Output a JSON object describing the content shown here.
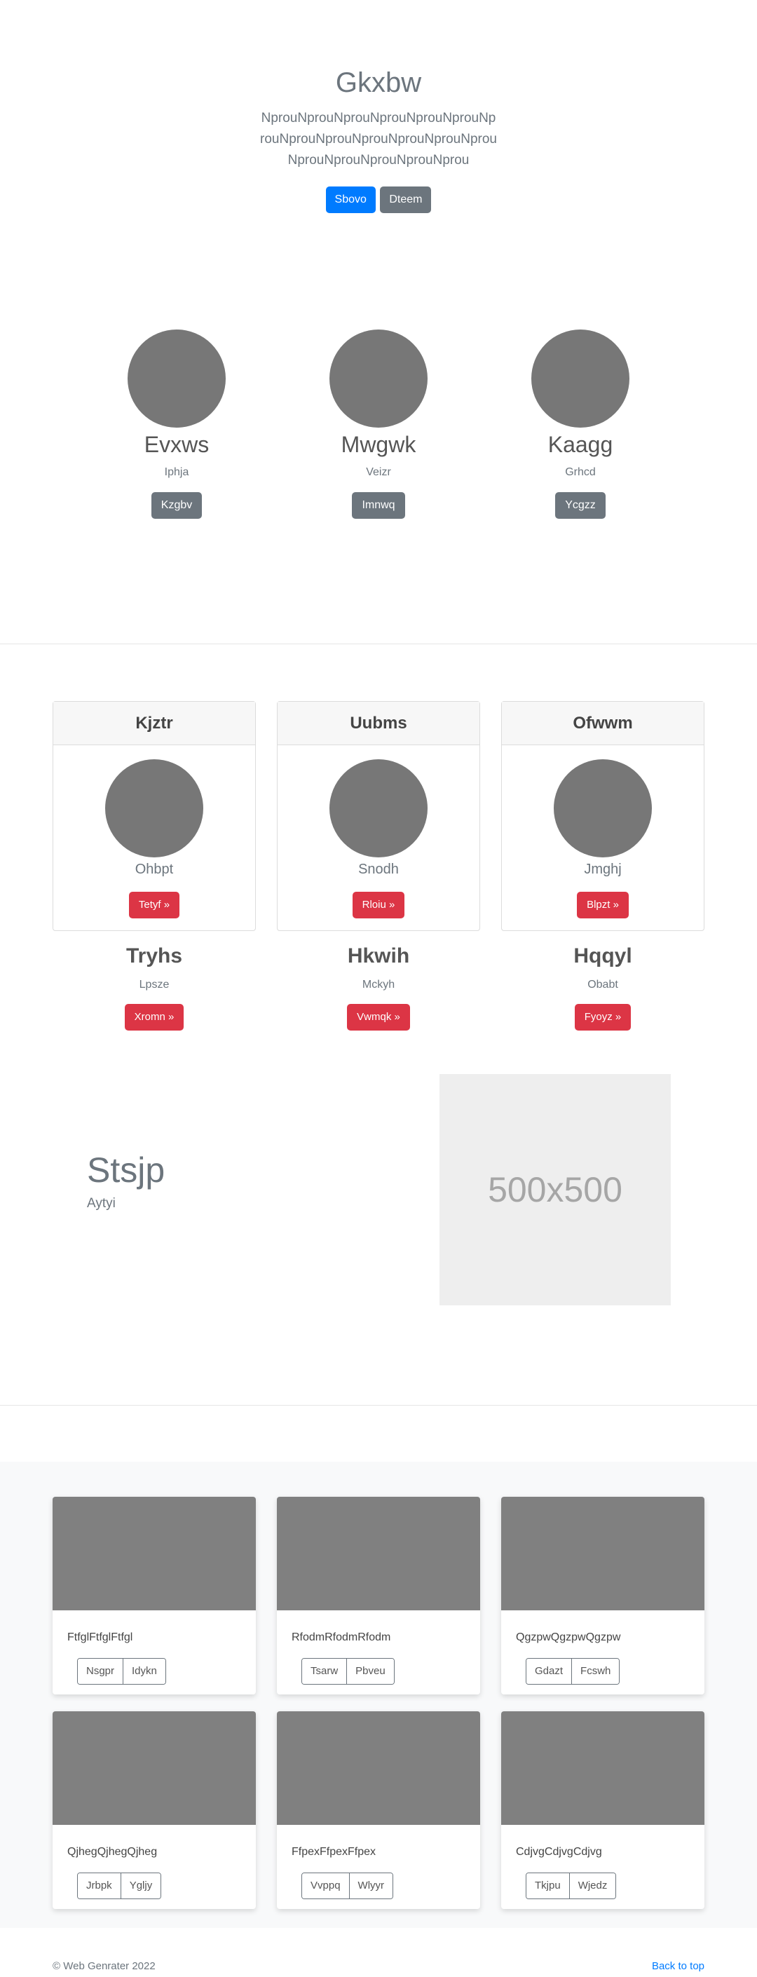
{
  "hero": {
    "title": "Gkxbw",
    "lead": "NprouNprouNprouNprouNprouNprouNprouNprouNprouNprouNprouNprouNprouNprouNprouNprouNprouNprou",
    "primary_label": "Sbovo",
    "secondary_label": "Dteem"
  },
  "features": [
    {
      "title": "Evxws",
      "text": "Iphja",
      "button": "Kzgbv"
    },
    {
      "title": "Mwgwk",
      "text": "Veizr",
      "button": "Imnwq"
    },
    {
      "title": "Kaagg",
      "text": "Grhcd",
      "button": "Ycgzz"
    }
  ],
  "header_cards": [
    {
      "header": "Kjztr",
      "subtitle": "Ohbpt",
      "button": "Tetyf »"
    },
    {
      "header": "Uubms",
      "subtitle": "Snodh",
      "button": "Rloiu »"
    },
    {
      "header": "Ofwwm",
      "subtitle": "Jmghj",
      "button": "Blpzt »"
    }
  ],
  "sub_features": [
    {
      "title": "Tryhs",
      "text": "Lpsze",
      "button": "Xromn »"
    },
    {
      "title": "Hkwih",
      "text": "Mckyh",
      "button": "Vwmqk »"
    },
    {
      "title": "Hqqyl",
      "text": "Obabt",
      "button": "Fyoyz »"
    }
  ],
  "featurette": {
    "title": "Stsjp",
    "subtitle": "Aytyi",
    "placeholder_text": "500x500"
  },
  "album": [
    {
      "text": "FtfglFtfglFtfgl",
      "btn1": "Nsgpr",
      "btn2": "Idykn"
    },
    {
      "text": "RfodmRfodmRfodm",
      "btn1": "Tsarw",
      "btn2": "Pbveu"
    },
    {
      "text": "QgzpwQgzpwQgzpw",
      "btn1": "Gdazt",
      "btn2": "Fcswh"
    },
    {
      "text": "QjhegQjhegQjheg",
      "btn1": "Jrbpk",
      "btn2": "Ygljy"
    },
    {
      "text": "FfpexFfpexFfpex",
      "btn1": "Vvppq",
      "btn2": "Wlyyr"
    },
    {
      "text": "CdjvgCdjvgCdjvg",
      "btn1": "Tkjpu",
      "btn2": "Wjedz"
    }
  ],
  "footer": {
    "copyright": "© Web Genrater 2022",
    "back_to_top": "Back to top"
  },
  "colors": {
    "primary": "#007bff",
    "secondary": "#6c757d",
    "danger": "#dc3545",
    "placeholder_gray": "#777777"
  }
}
